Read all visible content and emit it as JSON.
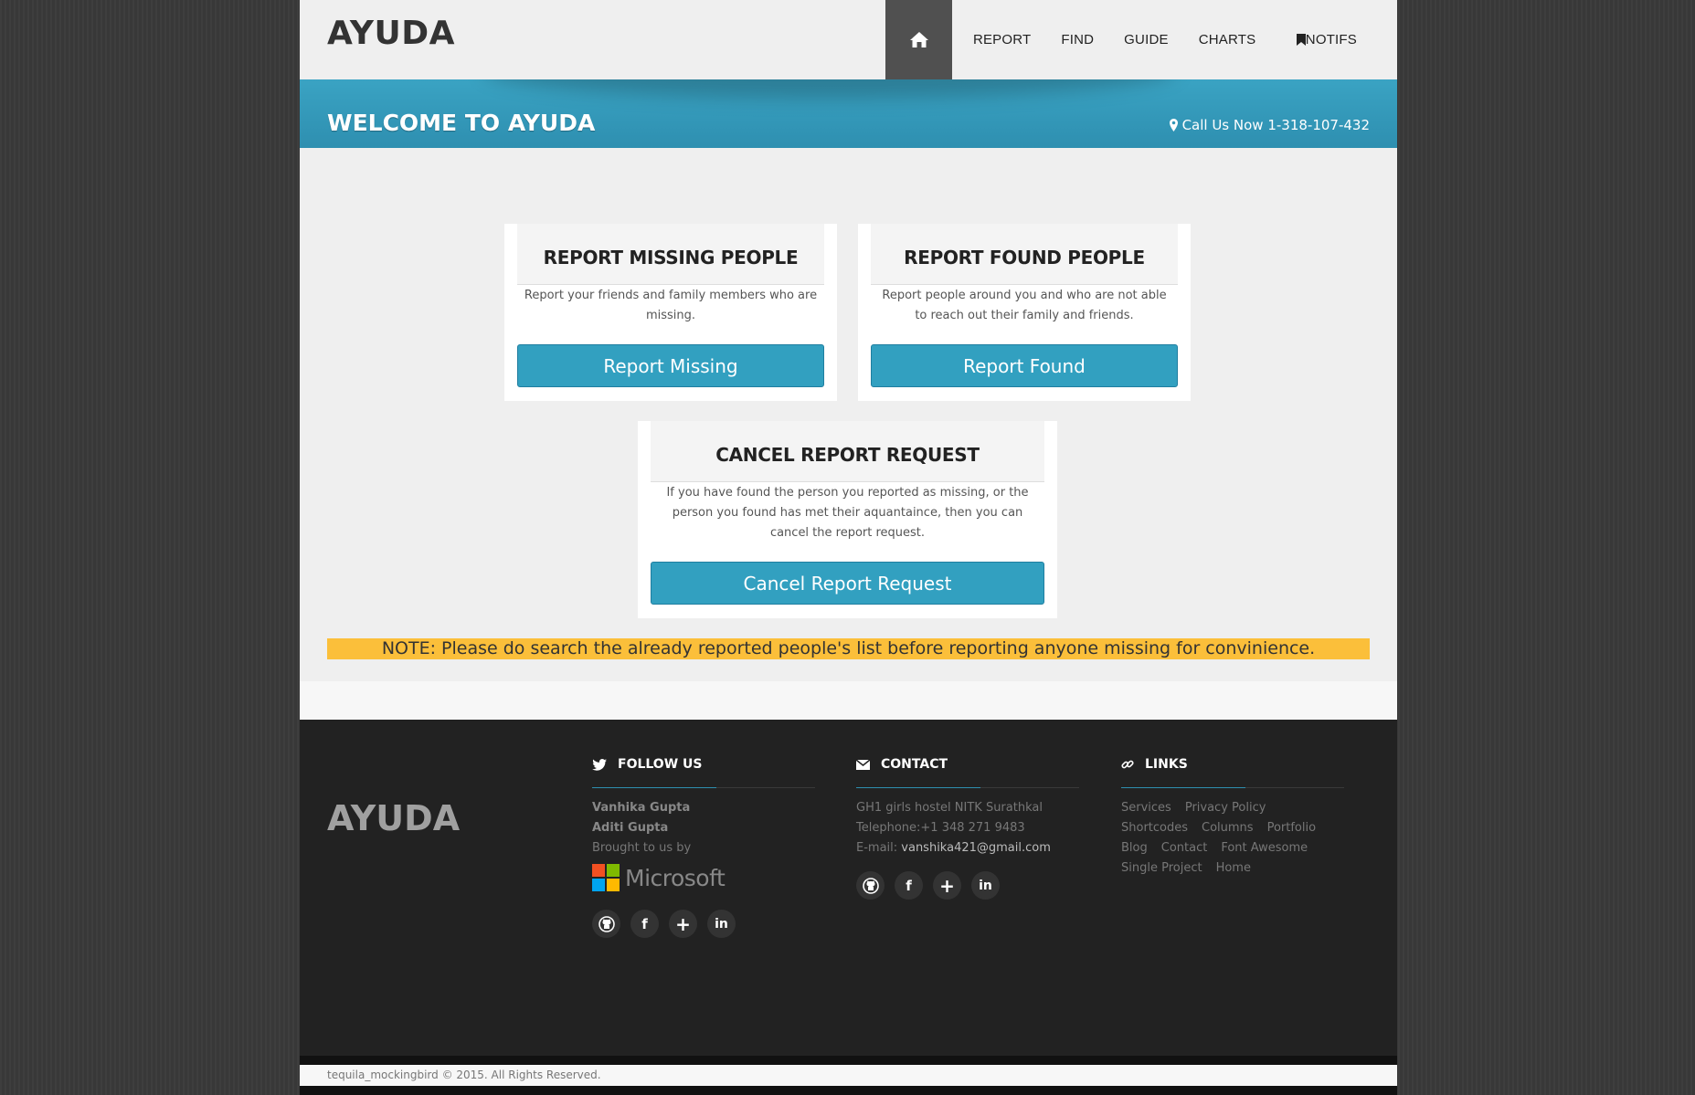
{
  "header": {
    "logo": "AYUDA",
    "nav": [
      "REPORT",
      "FIND",
      "GUIDE",
      "CHARTS"
    ],
    "nav_notifs": "NOTIFS"
  },
  "welcome": {
    "title": "WELCOME TO AYUDA",
    "call": "Call Us Now 1-318-107-432"
  },
  "cards": [
    {
      "title": "REPORT MISSING PEOPLE",
      "text": "Report your friends and family members who are missing.",
      "button": "Report Missing"
    },
    {
      "title": "REPORT FOUND PEOPLE",
      "text": "Report people around you and who are not able to reach out their family and friends.",
      "button": "Report Found"
    },
    {
      "title": "CANCEL REPORT REQUEST",
      "text": "If you have found the person you reported as missing, or the person you found has met their aquantaince, then you can cancel the report request.",
      "button": "Cancel Report Request"
    }
  ],
  "note": "NOTE: Please do search the already reported people's list before reporting anyone missing for convinience.",
  "footer": {
    "logo": "AYUDA",
    "follow": {
      "title": "FOLLOW US",
      "names": [
        "Vanhika Gupta",
        "Aditi Gupta"
      ],
      "brought": "Brought to us by",
      "brand": "Microsoft"
    },
    "contact": {
      "title": "CONTACT",
      "address": "GH1 girls hostel NITK Surathkal",
      "telephone": "Telephone:+1 348 271 9483",
      "email_label": "E-mail: ",
      "email": "vanshika421@gmail.com"
    },
    "links": {
      "title": "LINKS",
      "items": [
        "Services",
        "Privacy Policy",
        "Shortcodes",
        "Columns",
        "Portfolio",
        "Blog",
        "Contact",
        "Font Awesome",
        "Single Project",
        "Home"
      ]
    },
    "social_icons": [
      "github-icon",
      "facebook-icon",
      "google-plus-icon",
      "linkedin-icon"
    ],
    "social_glyphs": [
      "f",
      "+",
      "in"
    ]
  },
  "copyright": "tequila_mockingbird © 2015. All Rights Reserved.",
  "colors": {
    "accent": "#32a0c0",
    "note_bg": "#fbbf3a",
    "footer_bg": "#222222"
  }
}
